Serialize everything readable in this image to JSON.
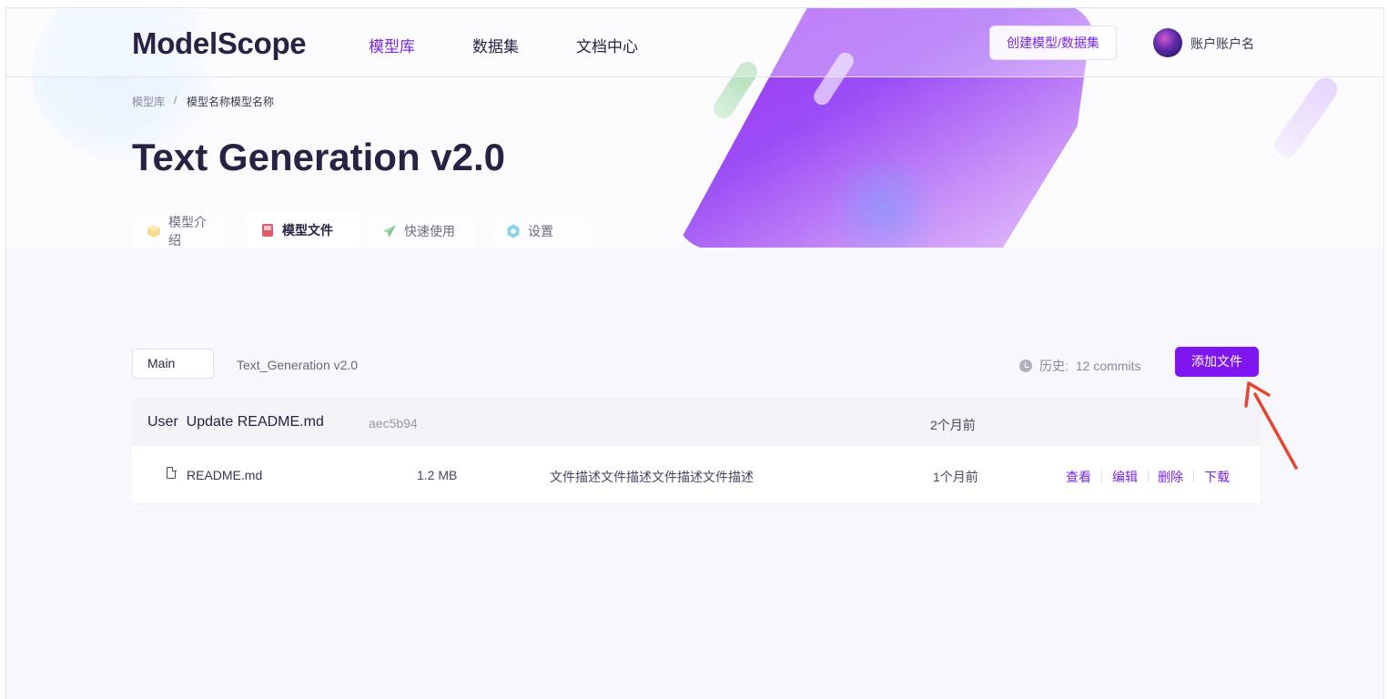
{
  "header": {
    "logo": "ModelScope",
    "nav": [
      {
        "label": "模型库",
        "active": true
      },
      {
        "label": "数据集",
        "active": false
      },
      {
        "label": "文档中心",
        "active": false
      }
    ],
    "create_button": "创建模型/数据集",
    "username": "账户账户名"
  },
  "breadcrumb": {
    "root": "模型库",
    "separator": "/",
    "current": "模型名称模型名称"
  },
  "title": "Text Generation v2.0",
  "tabs": [
    {
      "label": "模型介绍",
      "icon": "cube-icon",
      "active": false
    },
    {
      "label": "模型文件",
      "icon": "book-icon",
      "active": true
    },
    {
      "label": "快速使用",
      "icon": "paper-plane-icon",
      "active": false
    },
    {
      "label": "设置",
      "icon": "gear-icon",
      "active": false
    }
  ],
  "toolbar": {
    "branch": "Main",
    "repo_name": "Text_Generation v2.0",
    "history_label": "历史:",
    "history_value": "12 commits",
    "add_file_button": "添加文件"
  },
  "commit": {
    "message": "User  Update README.md",
    "hash": "aec5b94",
    "time": "2个月前"
  },
  "files": [
    {
      "name": "README.md",
      "size": "1.2 MB",
      "description": "文件描述文件描述文件描述文件描述",
      "time": "1个月前",
      "actions": [
        "查看",
        "编辑",
        "删除",
        "下载"
      ]
    }
  ],
  "colors": {
    "accent": "#7f16f0",
    "accent_text": "#7a25e8",
    "title": "#2a2144",
    "annotation_arrow": "#e8452f"
  }
}
